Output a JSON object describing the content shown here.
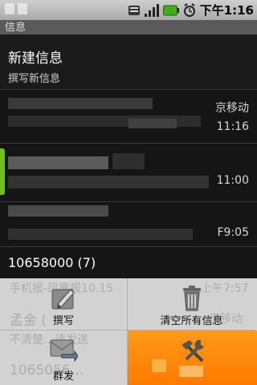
{
  "status_bar": {
    "time": "下午1:16",
    "icons": [
      "usb-icon",
      "sim-icon",
      "signal-icon",
      "battery-icon",
      "alarm-icon"
    ]
  },
  "app": {
    "title": "信息"
  },
  "new_message": {
    "title": "新建信息",
    "subtitle": "撰写新信息"
  },
  "threads": [
    {
      "sender_partial": "京移动",
      "time": "11:16"
    },
    {
      "time": "11:00"
    },
    {
      "time": "F9:05"
    },
    {
      "sender": "10658000 (7)"
    }
  ],
  "background_rows": [
    {
      "snippet": "手机报-凤凰报10.15",
      "time": "上午7:57"
    },
    {
      "sender": "孟金 (",
      "time": "京移动",
      "snippet": "不清楚…请发送"
    },
    {
      "sender": "1065056…"
    }
  ],
  "menu": {
    "items": [
      {
        "label": "撰写",
        "icon": "compose-icon"
      },
      {
        "label": "清空所有信息",
        "icon": "trash-icon"
      },
      {
        "label": "群发",
        "icon": "broadcast-icon"
      },
      {
        "label": "",
        "icon": "tools-icon"
      }
    ],
    "selected_index": 3
  }
}
